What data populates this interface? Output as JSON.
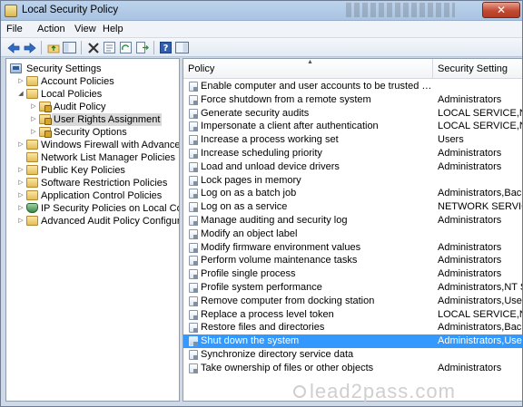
{
  "window": {
    "title": "Local Security Policy",
    "close_symbol": "✕"
  },
  "menu": [
    "File",
    "Action",
    "View",
    "Help"
  ],
  "toolbar": {
    "icons": [
      "back-icon",
      "forward-icon",
      "up-folder-icon",
      "show-hide-tree-icon",
      "delete-icon",
      "properties-icon",
      "refresh-icon",
      "export-list-icon",
      "help-icon",
      "console-pane-icon"
    ]
  },
  "tree": {
    "items": [
      {
        "label": "Security Settings",
        "icon": "computer-icon",
        "arrow": ""
      },
      {
        "label": "Account Policies",
        "icon": "folder-icon",
        "arrow": "▷"
      },
      {
        "label": "Local Policies",
        "icon": "folder-icon",
        "arrow": "◢"
      },
      {
        "label": "Audit Policy",
        "icon": "folder-lock-icon",
        "arrow": "▷"
      },
      {
        "label": "User Rights Assignment",
        "icon": "folder-lock-icon",
        "arrow": "▷",
        "selected": true
      },
      {
        "label": "Security Options",
        "icon": "folder-lock-icon",
        "arrow": "▷"
      },
      {
        "label": "Windows Firewall with Advanced Sec",
        "icon": "folder-icon",
        "arrow": "▷"
      },
      {
        "label": "Network List Manager Policies",
        "icon": "folder-icon",
        "arrow": ""
      },
      {
        "label": "Public Key Policies",
        "icon": "folder-icon",
        "arrow": "▷"
      },
      {
        "label": "Software Restriction Policies",
        "icon": "folder-icon",
        "arrow": "▷"
      },
      {
        "label": "Application Control Policies",
        "icon": "folder-icon",
        "arrow": "▷"
      },
      {
        "label": "IP Security Policies on Local Compute",
        "icon": "network-shield-icon",
        "arrow": "▷"
      },
      {
        "label": "Advanced Audit Policy Configuration",
        "icon": "folder-icon",
        "arrow": "▷"
      }
    ]
  },
  "list": {
    "columns": {
      "policy": "Policy",
      "setting": "Security Setting"
    },
    "sort_arrow": "▲",
    "rows": [
      {
        "policy": "Enable computer and user accounts to be trusted for delega...",
        "setting": ""
      },
      {
        "policy": "Force shutdown from a remote system",
        "setting": "Administrators"
      },
      {
        "policy": "Generate security audits",
        "setting": "LOCAL SERVICE,NETWO"
      },
      {
        "policy": "Impersonate a client after authentication",
        "setting": "LOCAL SERVICE,NETWO"
      },
      {
        "policy": "Increase a process working set",
        "setting": "Users"
      },
      {
        "policy": "Increase scheduling priority",
        "setting": "Administrators"
      },
      {
        "policy": "Load and unload device drivers",
        "setting": "Administrators"
      },
      {
        "policy": "Lock pages in memory",
        "setting": ""
      },
      {
        "policy": "Log on as a batch job",
        "setting": "Administrators,Backup"
      },
      {
        "policy": "Log on as a service",
        "setting": "NETWORK SERVICE,SQ"
      },
      {
        "policy": "Manage auditing and security log",
        "setting": "Administrators"
      },
      {
        "policy": "Modify an object label",
        "setting": ""
      },
      {
        "policy": "Modify firmware environment values",
        "setting": "Administrators"
      },
      {
        "policy": "Perform volume maintenance tasks",
        "setting": "Administrators"
      },
      {
        "policy": "Profile single process",
        "setting": "Administrators"
      },
      {
        "policy": "Profile system performance",
        "setting": "Administrators,NT SERV"
      },
      {
        "policy": "Remove computer from docking station",
        "setting": "Administrators,Users"
      },
      {
        "policy": "Replace a process level token",
        "setting": "LOCAL SERVICE,NETWO"
      },
      {
        "policy": "Restore files and directories",
        "setting": "Administrators,Backup"
      },
      {
        "policy": "Shut down the system",
        "setting": "Administrators,Users,Ba",
        "selected": true
      },
      {
        "policy": "Synchronize directory service data",
        "setting": ""
      },
      {
        "policy": "Take ownership of files or other objects",
        "setting": "Administrators"
      }
    ]
  },
  "watermark": {
    "text": "lead2pass.com"
  }
}
